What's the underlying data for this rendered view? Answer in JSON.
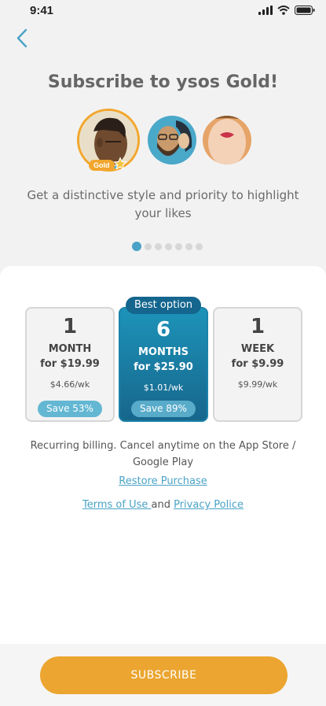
{
  "status_bar": {
    "time": "9:41"
  },
  "header": {
    "title": "Subscribe to ysos Gold!"
  },
  "avatars": {
    "gold_badge": "Gold"
  },
  "subtitle": "Get a distinctive style and priority to highlight your likes",
  "carousel": {
    "dot_count": 7,
    "active_index": 0
  },
  "plans": [
    {
      "number": "1",
      "unit": "MONTH",
      "price": "for $19.99",
      "weekly": "$4.66/wk",
      "save": "Save 53%"
    },
    {
      "number": "6",
      "unit": "MONTHS",
      "price": "for $25.90",
      "weekly": "$1.01/wk",
      "save": "Save 89%",
      "tag": "Best option"
    },
    {
      "number": "1",
      "unit": "WEEK",
      "price": "for $9.99",
      "weekly": "$9.99/wk"
    }
  ],
  "billing_note": "Recurring billing. Cancel anytime on the App Store / Google Play",
  "restore_label": "Restore Purchase",
  "legal": {
    "terms": "Terms of Use ",
    "and": " and ",
    "privacy": "Privacy Police"
  },
  "subscribe_label": "SUBSCRIBE",
  "colors": {
    "accent": "#4aa3c6",
    "gold": "#f2a62d",
    "selected": "#17668c",
    "button": "#eba530"
  }
}
